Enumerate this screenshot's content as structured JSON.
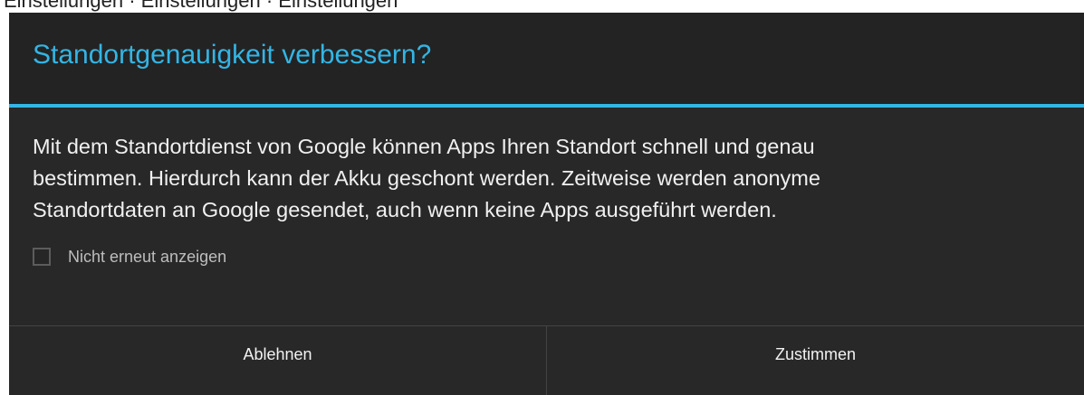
{
  "top_strip_text": "Einstellungen · Einstellungen · Einstellungen",
  "dialog": {
    "title": "Standortgenauigkeit verbessern?",
    "message_lines": [
      "Mit dem Standortdienst von Google können Apps Ihren Standort schnell und genau",
      "bestimmen. Hierdurch kann der Akku geschont werden. Zeitweise werden anonyme",
      "Standortdaten an Google gesendet, auch wenn keine Apps ausgeführt werden."
    ],
    "checkbox": {
      "label": "Nicht erneut anzeigen",
      "checked": false
    },
    "buttons": {
      "decline": "Ablehnen",
      "accept": "Zustimmen"
    }
  },
  "colors": {
    "accent": "#33b5e5",
    "dialog_background": "#282828",
    "title_background": "#232323",
    "text": "#f0f0f0"
  }
}
